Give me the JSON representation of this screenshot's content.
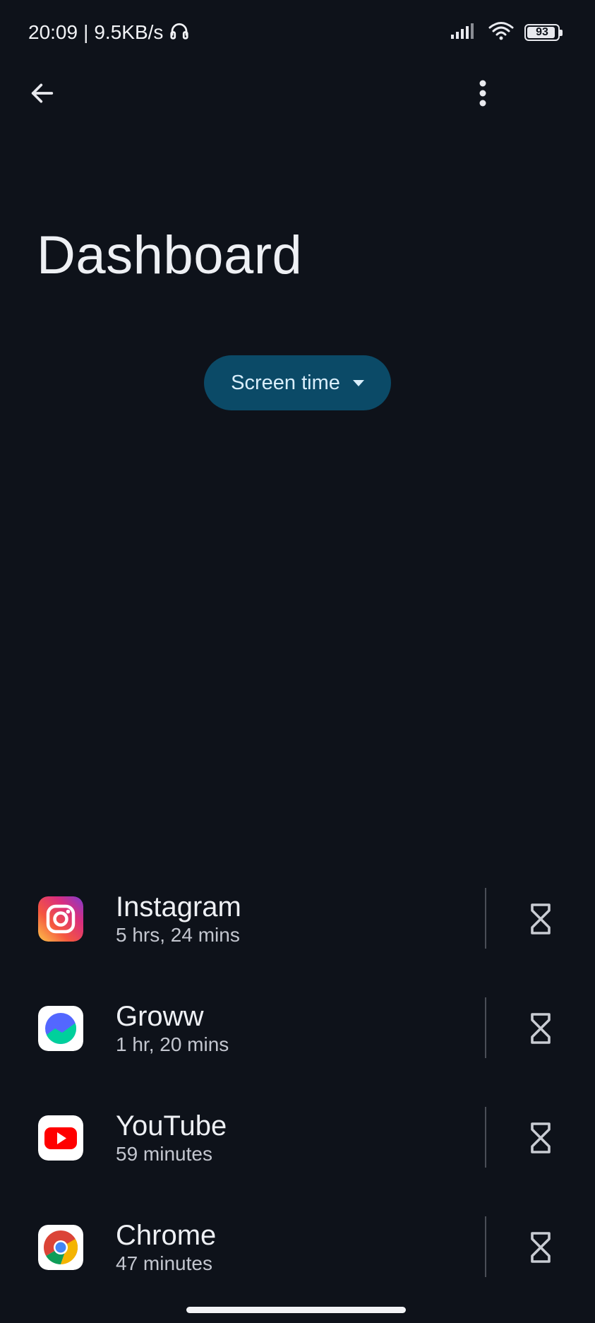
{
  "status_bar": {
    "time": "20:09",
    "separator": "|",
    "network_speed": "9.5KB/s",
    "battery_level": "93",
    "battery_fraction": 0.93,
    "icons": [
      "headphones-icon",
      "signal-icon",
      "wifi-icon",
      "battery-icon"
    ]
  },
  "top_bar": {
    "back_icon": "arrow-left-icon",
    "menu_icon": "more-vert-icon"
  },
  "page": {
    "title": "Dashboard"
  },
  "dropdown": {
    "selected": "Screen time",
    "icon": "caret-down-icon"
  },
  "apps": [
    {
      "name": "Instagram",
      "usage": "5 hrs, 24 mins",
      "icon": "instagram-icon"
    },
    {
      "name": "Groww",
      "usage": "1 hr, 20 mins",
      "icon": "groww-icon"
    },
    {
      "name": "YouTube",
      "usage": "59 minutes",
      "icon": "youtube-icon"
    },
    {
      "name": "Chrome",
      "usage": "47 minutes",
      "icon": "chrome-icon"
    }
  ],
  "row_action_icon": "hourglass-icon",
  "colors": {
    "background": "#0e121a",
    "chip": "#0b4a67",
    "chip_text": "#d9eefb",
    "text_primary": "#eef0f4",
    "text_secondary": "#c3c6cf"
  }
}
